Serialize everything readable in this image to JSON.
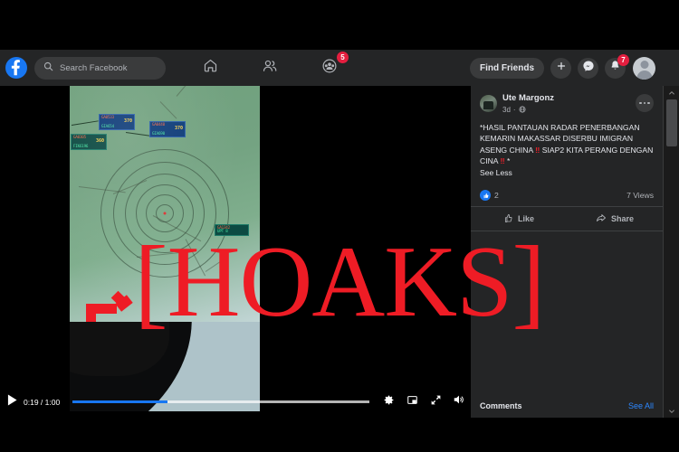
{
  "app": {
    "name": "Facebook",
    "theme_bg": "#18191a",
    "surface": "#242526",
    "accent": "#1877f2",
    "hoax_red": "#ee1c25"
  },
  "topbar": {
    "logo_icon": "facebook-logo-icon",
    "search": {
      "placeholder": "Search Facebook",
      "value": "",
      "icon": "search-icon"
    },
    "nav": [
      {
        "name": "home",
        "icon": "home-icon",
        "badge": ""
      },
      {
        "name": "friends",
        "icon": "friends-icon",
        "badge": ""
      },
      {
        "name": "groups",
        "icon": "groups-icon",
        "badge": "5"
      }
    ],
    "find_friends_label": "Find Friends",
    "create_icon": "plus-icon",
    "messenger_icon": "messenger-icon",
    "notifications_icon": "bell-icon",
    "notifications_badge": "7",
    "profile_icon": "avatar-icon"
  },
  "video": {
    "current_time": "0:19",
    "duration": "1:00",
    "time_display": "0:19 / 1:00",
    "progress_percent": 32,
    "buffered_percent": 100,
    "play_icon": "play-icon",
    "settings_icon": "gear-icon",
    "miniplayer_icon": "miniplayer-icon",
    "fullscreen_icon": "fullscreen-icon",
    "volume_icon": "volume-icon",
    "watermark": "[HOAKS]",
    "radar_tags": [
      {
        "callsign": "GA0533",
        "altitude": "370",
        "id": "GIA654"
      },
      {
        "callsign": "GA0305",
        "altitude": "360",
        "id": "FIK6196"
      },
      {
        "callsign": "GA0440",
        "altitude": "370",
        "id": "GIA690"
      },
      {
        "callsign": "GA1342",
        "altitude": "",
        "id": "UPT 8"
      }
    ]
  },
  "post": {
    "author": "Ute Margonz",
    "time_ago": "3d",
    "privacy_icon": "globe-icon",
    "menu_icon": "ellipsis-icon",
    "text_line1": "*HASIL PANTAUAN RADAR PENERBANGAN",
    "text_line2": "KEMARIN MAKASSAR DISERBU IMIGRAN ASENG",
    "text_line3_a": "CHINA ",
    "text_line3_bang1": "‼",
    "text_line3_b": " SIAP2 KITA PERANG DENGAN CINA ",
    "text_line3_bang2": "‼",
    "text_line3_c": " *",
    "see_less_label": "See Less",
    "reaction_icon": "thumbs-up-icon",
    "reaction_count": "2",
    "views": "7 Views",
    "like_label": "Like",
    "like_icon": "like-outline-icon",
    "share_label": "Share",
    "share_icon": "share-icon",
    "comments_label": "Comments",
    "see_all_label": "See All"
  },
  "scrollbar": {
    "up_icon": "chevron-up-icon",
    "down_icon": "chevron-down-icon"
  }
}
